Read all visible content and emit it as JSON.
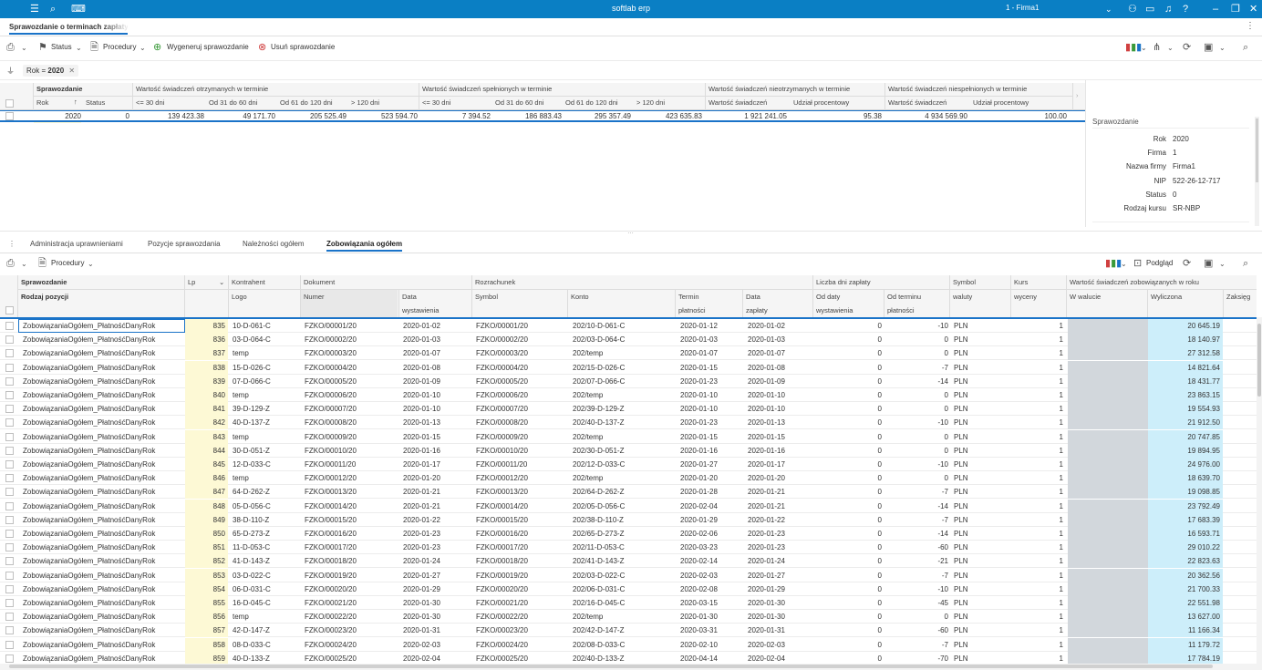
{
  "app": {
    "title": "softlab erp",
    "firm_selector": "1 - Firma1"
  },
  "document_tab": {
    "label": "Sprawozdanie o terminach zapłaty"
  },
  "toolbar": {
    "status_label": "Status",
    "procedury_label": "Procedury",
    "generate_label": "Wygeneruj sprawozdanie",
    "delete_label": "Usuń sprawozdanie"
  },
  "filter": {
    "chip_field": "Rok",
    "chip_op": "=",
    "chip_value": "2020"
  },
  "upper_grid": {
    "group_headers": {
      "sprawozdanie": "Sprawozdanie",
      "otrzymanych": "Wartość świadczeń otrzymanych w terminie",
      "spelnionych": "Wartość świadczeń spełnionych w terminie",
      "nieotrzymanych": "Wartość świadczeń nieotrzymanych w terminie",
      "niespelnionych": "Wartość świadczeń niespełnionych w terminie"
    },
    "columns": {
      "rok": "Rok",
      "status": "Status",
      "c30": "<= 30 dni",
      "c31_60": "Od 31 do 60 dni",
      "c61_120": "Od 61 do 120 dni",
      "c120": "> 120 dni",
      "wartosc": "Wartość świadczeń",
      "udzial": "Udział procentowy"
    },
    "row": {
      "rok": "2020",
      "status": "0",
      "o30": "139 423.38",
      "o31_60": "49 171.70",
      "o61_120": "205 525.49",
      "o120": "523 594.70",
      "s30": "7 394.52",
      "s31_60": "186 883.43",
      "s61_120": "295 357.49",
      "s120": "423 635.83",
      "nieotrz_wartosc": "1 921 241.05",
      "nieotrz_udzial": "95.38",
      "niespel_wartosc": "4 934 569.90",
      "niespel_udzial": "100.00"
    }
  },
  "side_panel": {
    "title": "Sprawozdanie",
    "fields": [
      {
        "label": "Rok",
        "value": "2020"
      },
      {
        "label": "Firma",
        "value": "1"
      },
      {
        "label": "Nazwa firmy",
        "value": "Firma1"
      },
      {
        "label": "NIP",
        "value": "522-26-12-717"
      },
      {
        "label": "Status",
        "value": "0"
      },
      {
        "label": "Rodzaj kursu",
        "value": "SR-NBP"
      }
    ]
  },
  "lower_tabs": [
    {
      "label": "Administracja uprawnieniami"
    },
    {
      "label": "Pozycje sprawozdania"
    },
    {
      "label": "Należności ogółem"
    },
    {
      "label": "Zobowiązania ogółem"
    }
  ],
  "lower_toolbar": {
    "procedury_label": "Procedury",
    "podglad_label": "Podgląd"
  },
  "lower_grid": {
    "group_headers": {
      "sprawozdanie": "Sprawozdanie",
      "kontrahent": "Kontrahent",
      "dokument": "Dokument",
      "rozrachunek": "Rozrachunek",
      "liczba_dni": "Liczba dni zapłaty",
      "symbol": "Symbol",
      "kurs": "Kurs",
      "wartosc": "Wartość świadczeń zobowiązanych w roku"
    },
    "columns": {
      "rodzaj": "Rodzaj pozycji",
      "lp": "Lp",
      "logo": "Logo",
      "numer": "Numer",
      "data_wyst_1": "Data",
      "data_wyst_2": "wystawienia",
      "symbol": "Symbol",
      "konto": "Konto",
      "termin_1": "Termin",
      "termin_2": "płatności",
      "data_zap_1": "Data",
      "data_zap_2": "zapłaty",
      "od_daty_1": "Od daty",
      "od_daty_2": "wystawienia",
      "od_terminu_1": "Od terminu",
      "od_terminu_2": "płatności",
      "waluty": "waluty",
      "wyceny": "wyceny",
      "w_walucie": "W walucie",
      "wyliczona": "Wyliczona",
      "zaksieg": "Zaksięg"
    },
    "rows": [
      {
        "rodzaj": "ZobowiązaniaOgółem_PłatnośćDanyRok",
        "lp": "835",
        "logo": "10-D-061-C",
        "numer": "FZKO/00001/20",
        "data_wyst": "2020-01-02",
        "symbol": "FZKO/00001/20",
        "konto": "202/10-D-061-C",
        "termin": "2020-01-12",
        "data_zap": "2020-01-02",
        "od_daty": "0",
        "od_terminu": "-10",
        "waluta": "PLN",
        "kurs": "1",
        "wyliczona": "20 645.19"
      },
      {
        "rodzaj": "ZobowiązaniaOgółem_PłatnośćDanyRok",
        "lp": "836",
        "logo": "03-D-064-C",
        "numer": "FZKO/00002/20",
        "data_wyst": "2020-01-03",
        "symbol": "FZKO/00002/20",
        "konto": "202/03-D-064-C",
        "termin": "2020-01-03",
        "data_zap": "2020-01-03",
        "od_daty": "0",
        "od_terminu": "0",
        "waluta": "PLN",
        "kurs": "1",
        "wyliczona": "18 140.97"
      },
      {
        "rodzaj": "ZobowiązaniaOgółem_PłatnośćDanyRok",
        "lp": "837",
        "logo": "temp",
        "numer": "FZKO/00003/20",
        "data_wyst": "2020-01-07",
        "symbol": "FZKO/00003/20",
        "konto": "202/temp",
        "termin": "2020-01-07",
        "data_zap": "2020-01-07",
        "od_daty": "0",
        "od_terminu": "0",
        "waluta": "PLN",
        "kurs": "1",
        "wyliczona": "27 312.58"
      },
      {
        "rodzaj": "ZobowiązaniaOgółem_PłatnośćDanyRok",
        "lp": "838",
        "logo": "15-D-026-C",
        "numer": "FZKO/00004/20",
        "data_wyst": "2020-01-08",
        "symbol": "FZKO/00004/20",
        "konto": "202/15-D-026-C",
        "termin": "2020-01-15",
        "data_zap": "2020-01-08",
        "od_daty": "0",
        "od_terminu": "-7",
        "waluta": "PLN",
        "kurs": "1",
        "wyliczona": "14 821.64"
      },
      {
        "rodzaj": "ZobowiązaniaOgółem_PłatnośćDanyRok",
        "lp": "839",
        "logo": "07-D-066-C",
        "numer": "FZKO/00005/20",
        "data_wyst": "2020-01-09",
        "symbol": "FZKO/00005/20",
        "konto": "202/07-D-066-C",
        "termin": "2020-01-23",
        "data_zap": "2020-01-09",
        "od_daty": "0",
        "od_terminu": "-14",
        "waluta": "PLN",
        "kurs": "1",
        "wyliczona": "18 431.77"
      },
      {
        "rodzaj": "ZobowiązaniaOgółem_PłatnośćDanyRok",
        "lp": "840",
        "logo": "temp",
        "numer": "FZKO/00006/20",
        "data_wyst": "2020-01-10",
        "symbol": "FZKO/00006/20",
        "konto": "202/temp",
        "termin": "2020-01-10",
        "data_zap": "2020-01-10",
        "od_daty": "0",
        "od_terminu": "0",
        "waluta": "PLN",
        "kurs": "1",
        "wyliczona": "23 863.15"
      },
      {
        "rodzaj": "ZobowiązaniaOgółem_PłatnośćDanyRok",
        "lp": "841",
        "logo": "39-D-129-Z",
        "numer": "FZKO/00007/20",
        "data_wyst": "2020-01-10",
        "symbol": "FZKO/00007/20",
        "konto": "202/39-D-129-Z",
        "termin": "2020-01-10",
        "data_zap": "2020-01-10",
        "od_daty": "0",
        "od_terminu": "0",
        "waluta": "PLN",
        "kurs": "1",
        "wyliczona": "19 554.93"
      },
      {
        "rodzaj": "ZobowiązaniaOgółem_PłatnośćDanyRok",
        "lp": "842",
        "logo": "40-D-137-Z",
        "numer": "FZKO/00008/20",
        "data_wyst": "2020-01-13",
        "symbol": "FZKO/00008/20",
        "konto": "202/40-D-137-Z",
        "termin": "2020-01-23",
        "data_zap": "2020-01-13",
        "od_daty": "0",
        "od_terminu": "-10",
        "waluta": "PLN",
        "kurs": "1",
        "wyliczona": "21 912.50"
      },
      {
        "rodzaj": "ZobowiązaniaOgółem_PłatnośćDanyRok",
        "lp": "843",
        "logo": "temp",
        "numer": "FZKO/00009/20",
        "data_wyst": "2020-01-15",
        "symbol": "FZKO/00009/20",
        "konto": "202/temp",
        "termin": "2020-01-15",
        "data_zap": "2020-01-15",
        "od_daty": "0",
        "od_terminu": "0",
        "waluta": "PLN",
        "kurs": "1",
        "wyliczona": "20 747.85"
      },
      {
        "rodzaj": "ZobowiązaniaOgółem_PłatnośćDanyRok",
        "lp": "844",
        "logo": "30-D-051-Z",
        "numer": "FZKO/00010/20",
        "data_wyst": "2020-01-16",
        "symbol": "FZKO/00010/20",
        "konto": "202/30-D-051-Z",
        "termin": "2020-01-16",
        "data_zap": "2020-01-16",
        "od_daty": "0",
        "od_terminu": "0",
        "waluta": "PLN",
        "kurs": "1",
        "wyliczona": "19 894.95"
      },
      {
        "rodzaj": "ZobowiązaniaOgółem_PłatnośćDanyRok",
        "lp": "845",
        "logo": "12-D-033-C",
        "numer": "FZKO/00011/20",
        "data_wyst": "2020-01-17",
        "symbol": "FZKO/00011/20",
        "konto": "202/12-D-033-C",
        "termin": "2020-01-27",
        "data_zap": "2020-01-17",
        "od_daty": "0",
        "od_terminu": "-10",
        "waluta": "PLN",
        "kurs": "1",
        "wyliczona": "24 976.00"
      },
      {
        "rodzaj": "ZobowiązaniaOgółem_PłatnośćDanyRok",
        "lp": "846",
        "logo": "temp",
        "numer": "FZKO/00012/20",
        "data_wyst": "2020-01-20",
        "symbol": "FZKO/00012/20",
        "konto": "202/temp",
        "termin": "2020-01-20",
        "data_zap": "2020-01-20",
        "od_daty": "0",
        "od_terminu": "0",
        "waluta": "PLN",
        "kurs": "1",
        "wyliczona": "18 639.70"
      },
      {
        "rodzaj": "ZobowiązaniaOgółem_PłatnośćDanyRok",
        "lp": "847",
        "logo": "64-D-262-Z",
        "numer": "FZKO/00013/20",
        "data_wyst": "2020-01-21",
        "symbol": "FZKO/00013/20",
        "konto": "202/64-D-262-Z",
        "termin": "2020-01-28",
        "data_zap": "2020-01-21",
        "od_daty": "0",
        "od_terminu": "-7",
        "waluta": "PLN",
        "kurs": "1",
        "wyliczona": "19 098.85"
      },
      {
        "rodzaj": "ZobowiązaniaOgółem_PłatnośćDanyRok",
        "lp": "848",
        "logo": "05-D-056-C",
        "numer": "FZKO/00014/20",
        "data_wyst": "2020-01-21",
        "symbol": "FZKO/00014/20",
        "konto": "202/05-D-056-C",
        "termin": "2020-02-04",
        "data_zap": "2020-01-21",
        "od_daty": "0",
        "od_terminu": "-14",
        "waluta": "PLN",
        "kurs": "1",
        "wyliczona": "23 792.49"
      },
      {
        "rodzaj": "ZobowiązaniaOgółem_PłatnośćDanyRok",
        "lp": "849",
        "logo": "38-D-110-Z",
        "numer": "FZKO/00015/20",
        "data_wyst": "2020-01-22",
        "symbol": "FZKO/00015/20",
        "konto": "202/38-D-110-Z",
        "termin": "2020-01-29",
        "data_zap": "2020-01-22",
        "od_daty": "0",
        "od_terminu": "-7",
        "waluta": "PLN",
        "kurs": "1",
        "wyliczona": "17 683.39"
      },
      {
        "rodzaj": "ZobowiązaniaOgółem_PłatnośćDanyRok",
        "lp": "850",
        "logo": "65-D-273-Z",
        "numer": "FZKO/00016/20",
        "data_wyst": "2020-01-23",
        "symbol": "FZKO/00016/20",
        "konto": "202/65-D-273-Z",
        "termin": "2020-02-06",
        "data_zap": "2020-01-23",
        "od_daty": "0",
        "od_terminu": "-14",
        "waluta": "PLN",
        "kurs": "1",
        "wyliczona": "16 593.71"
      },
      {
        "rodzaj": "ZobowiązaniaOgółem_PłatnośćDanyRok",
        "lp": "851",
        "logo": "11-D-053-C",
        "numer": "FZKO/00017/20",
        "data_wyst": "2020-01-23",
        "symbol": "FZKO/00017/20",
        "konto": "202/11-D-053-C",
        "termin": "2020-03-23",
        "data_zap": "2020-01-23",
        "od_daty": "0",
        "od_terminu": "-60",
        "waluta": "PLN",
        "kurs": "1",
        "wyliczona": "29 010.22"
      },
      {
        "rodzaj": "ZobowiązaniaOgółem_PłatnośćDanyRok",
        "lp": "852",
        "logo": "41-D-143-Z",
        "numer": "FZKO/00018/20",
        "data_wyst": "2020-01-24",
        "symbol": "FZKO/00018/20",
        "konto": "202/41-D-143-Z",
        "termin": "2020-02-14",
        "data_zap": "2020-01-24",
        "od_daty": "0",
        "od_terminu": "-21",
        "waluta": "PLN",
        "kurs": "1",
        "wyliczona": "22 823.63"
      },
      {
        "rodzaj": "ZobowiązaniaOgółem_PłatnośćDanyRok",
        "lp": "853",
        "logo": "03-D-022-C",
        "numer": "FZKO/00019/20",
        "data_wyst": "2020-01-27",
        "symbol": "FZKO/00019/20",
        "konto": "202/03-D-022-C",
        "termin": "2020-02-03",
        "data_zap": "2020-01-27",
        "od_daty": "0",
        "od_terminu": "-7",
        "waluta": "PLN",
        "kurs": "1",
        "wyliczona": "20 362.56"
      },
      {
        "rodzaj": "ZobowiązaniaOgółem_PłatnośćDanyRok",
        "lp": "854",
        "logo": "06-D-031-C",
        "numer": "FZKO/00020/20",
        "data_wyst": "2020-01-29",
        "symbol": "FZKO/00020/20",
        "konto": "202/06-D-031-C",
        "termin": "2020-02-08",
        "data_zap": "2020-01-29",
        "od_daty": "0",
        "od_terminu": "-10",
        "waluta": "PLN",
        "kurs": "1",
        "wyliczona": "21 700.33"
      },
      {
        "rodzaj": "ZobowiązaniaOgółem_PłatnośćDanyRok",
        "lp": "855",
        "logo": "16-D-045-C",
        "numer": "FZKO/00021/20",
        "data_wyst": "2020-01-30",
        "symbol": "FZKO/00021/20",
        "konto": "202/16-D-045-C",
        "termin": "2020-03-15",
        "data_zap": "2020-01-30",
        "od_daty": "0",
        "od_terminu": "-45",
        "waluta": "PLN",
        "kurs": "1",
        "wyliczona": "22 551.98"
      },
      {
        "rodzaj": "ZobowiązaniaOgółem_PłatnośćDanyRok",
        "lp": "856",
        "logo": "temp",
        "numer": "FZKO/00022/20",
        "data_wyst": "2020-01-30",
        "symbol": "FZKO/00022/20",
        "konto": "202/temp",
        "termin": "2020-01-30",
        "data_zap": "2020-01-30",
        "od_daty": "0",
        "od_terminu": "0",
        "waluta": "PLN",
        "kurs": "1",
        "wyliczona": "13 627.00"
      },
      {
        "rodzaj": "ZobowiązaniaOgółem_PłatnośćDanyRok",
        "lp": "857",
        "logo": "42-D-147-Z",
        "numer": "FZKO/00023/20",
        "data_wyst": "2020-01-31",
        "symbol": "FZKO/00023/20",
        "konto": "202/42-D-147-Z",
        "termin": "2020-03-31",
        "data_zap": "2020-01-31",
        "od_daty": "0",
        "od_terminu": "-60",
        "waluta": "PLN",
        "kurs": "1",
        "wyliczona": "11 166.34"
      },
      {
        "rodzaj": "ZobowiązaniaOgółem_PłatnośćDanyRok",
        "lp": "858",
        "logo": "08-D-033-C",
        "numer": "FZKO/00024/20",
        "data_wyst": "2020-02-03",
        "symbol": "FZKO/00024/20",
        "konto": "202/08-D-033-C",
        "termin": "2020-02-10",
        "data_zap": "2020-02-03",
        "od_daty": "0",
        "od_terminu": "-7",
        "waluta": "PLN",
        "kurs": "1",
        "wyliczona": "11 179.72"
      },
      {
        "rodzaj": "ZobowiązaniaOgółem_PłatnośćDanyRok",
        "lp": "859",
        "logo": "40-D-133-Z",
        "numer": "FZKO/00025/20",
        "data_wyst": "2020-02-04",
        "symbol": "FZKO/00025/20",
        "konto": "202/40-D-133-Z",
        "termin": "2020-04-14",
        "data_zap": "2020-02-04",
        "od_daty": "0",
        "od_terminu": "-70",
        "waluta": "PLN",
        "kurs": "1",
        "wyliczona": "17 784.19"
      }
    ]
  }
}
